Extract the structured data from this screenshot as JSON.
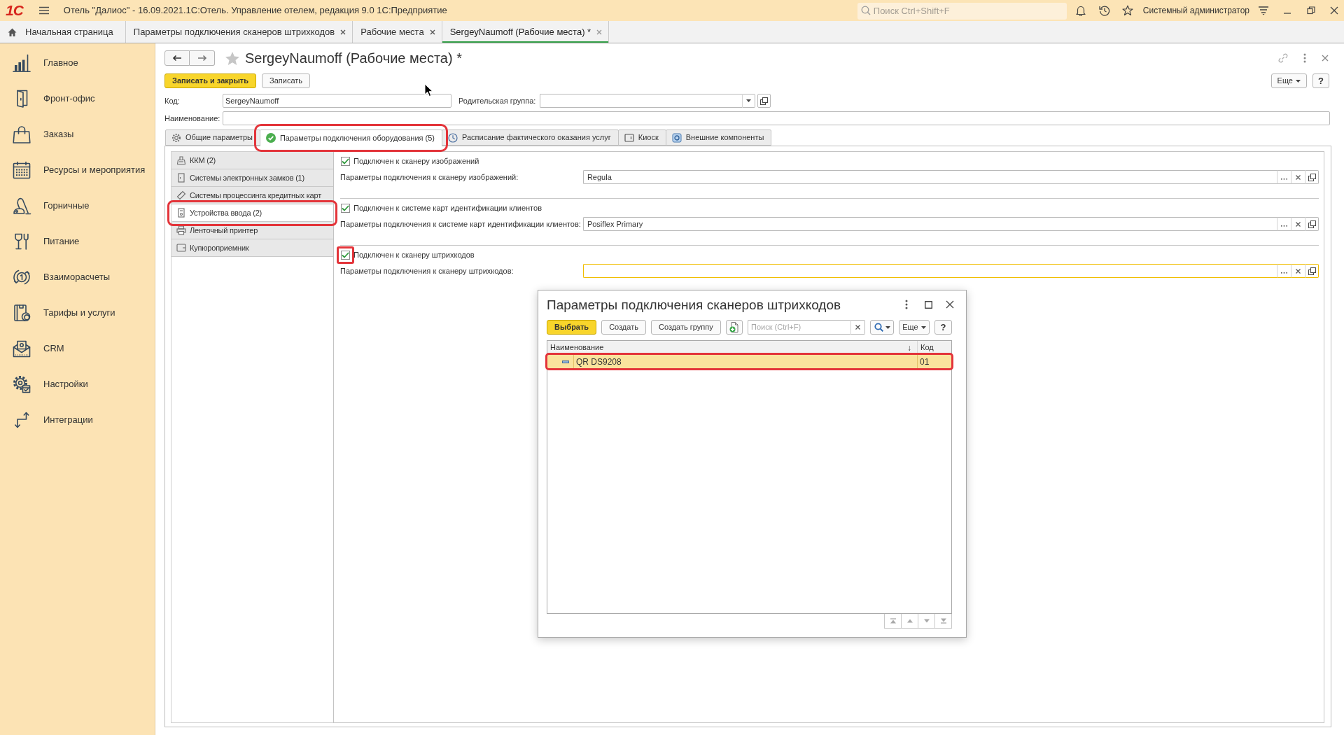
{
  "window": {
    "logo": "1С",
    "title": "Отель \"Далиос\" - 16.09.2021.1С:Отель. Управление отелем, редакция 9.0 1С:Предприятие",
    "search": {
      "placeholder": "Поиск Ctrl+Shift+F"
    },
    "user": "Системный администратор"
  },
  "open_tabs": [
    {
      "kind": "home",
      "label": "Начальная страница",
      "selected": false
    },
    {
      "kind": "page",
      "label": "Параметры подключения сканеров штрихкодов",
      "selected": false
    },
    {
      "kind": "page",
      "label": "Рабочие места",
      "selected": false
    },
    {
      "kind": "page",
      "label": "SergeyNaumoff (Рабочие места) *",
      "selected": true
    }
  ],
  "sidebar": {
    "items": [
      {
        "label": "Главное"
      },
      {
        "label": "Фронт-офис"
      },
      {
        "label": "Заказы"
      },
      {
        "label": "Ресурсы и мероприятия"
      },
      {
        "label": "Горничные"
      },
      {
        "label": "Питание"
      },
      {
        "label": "Взаиморасчеты"
      },
      {
        "label": "Тарифы и услуги"
      },
      {
        "label": "CRM"
      },
      {
        "label": "Настройки"
      },
      {
        "label": "Интеграции"
      }
    ]
  },
  "form": {
    "title": "SergeyNaumoff (Рабочие места) *",
    "favorite": false,
    "actions": [
      {
        "kind": "primary",
        "label": "Записать и закрыть"
      },
      {
        "kind": "default",
        "label": "Записать"
      }
    ],
    "more": "Еще",
    "help": "?",
    "code": {
      "label": "Код:",
      "value": "SergeyNaumoff"
    },
    "parent_group": {
      "label": "Родительская группа:"
    },
    "name": {
      "label": "Наименование:"
    },
    "tabs": [
      {
        "label": "Общие параметры",
        "selected": false,
        "highlighted": false
      },
      {
        "label": "Параметры подключения оборудования (5)",
        "selected": true,
        "highlighted": true
      },
      {
        "label": "Расписание фактического оказания услуг",
        "selected": false,
        "highlighted": false
      },
      {
        "label": "Киоск",
        "selected": false,
        "highlighted": false
      },
      {
        "label": "Внешние компоненты",
        "selected": false,
        "highlighted": false
      }
    ],
    "device_types": [
      {
        "label": "ККМ (2)",
        "selected": false,
        "highlighted": false
      },
      {
        "label": "Системы электронных замков (1)",
        "selected": false,
        "highlighted": false
      },
      {
        "label": "Системы процессинга кредитных карт",
        "selected": false,
        "highlighted": false
      },
      {
        "label": "Устройства ввода (2)",
        "selected": true,
        "highlighted": true
      },
      {
        "label": "Ленточный принтер",
        "selected": false,
        "highlighted": false
      },
      {
        "label": "Купюроприемник",
        "selected": false,
        "highlighted": false
      }
    ],
    "connections": [
      {
        "checkbox": {
          "label": "Подключен к сканеру изображений",
          "checked": true,
          "highlighted": false
        },
        "field": {
          "label": "Параметры подключения к сканеру изображений:",
          "value": "Regula",
          "focused": false
        }
      },
      {
        "checkbox": {
          "label": "Подключен к системе карт идентификации клиентов",
          "checked": true,
          "highlighted": false
        },
        "field": {
          "label": "Параметры подключения к системе карт идентификации клиентов:",
          "value": "Posiflex Primary",
          "focused": false
        }
      },
      {
        "checkbox": {
          "label": "Подключен к сканеру штрихкодов",
          "checked": true,
          "highlighted": true
        },
        "field": {
          "label": "Параметры подключения к сканеру штрихкодов:",
          "focused": true
        }
      }
    ]
  },
  "dialog": {
    "title": "Параметры подключения сканеров штрихкодов",
    "actions": [
      {
        "kind": "primary",
        "label": "Выбрать"
      },
      {
        "kind": "default",
        "label": "Создать"
      },
      {
        "kind": "default",
        "label": "Создать группу"
      }
    ],
    "search": {
      "placeholder": "Поиск (Ctrl+F)"
    },
    "more": "Еще",
    "help": "?",
    "table": {
      "columns": [
        {
          "label": "Наименование",
          "sort_mark": "↓"
        },
        {
          "label": "Код"
        }
      ],
      "rows": [
        {
          "cells": [
            "QR DS9208",
            "01"
          ],
          "selected": true,
          "highlighted": true
        }
      ]
    }
  }
}
